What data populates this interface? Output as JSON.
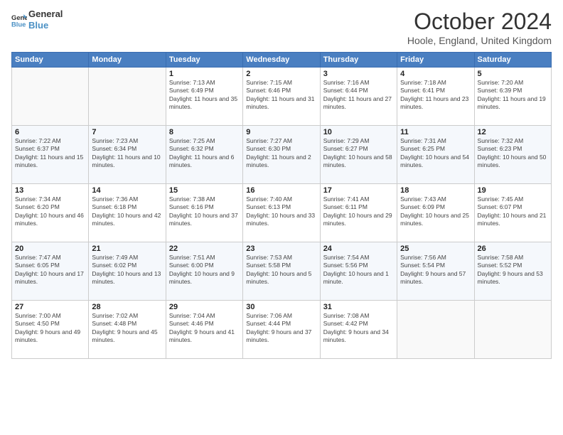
{
  "logo": {
    "line1": "General",
    "line2": "Blue"
  },
  "title": "October 2024",
  "location": "Hoole, England, United Kingdom",
  "days_of_week": [
    "Sunday",
    "Monday",
    "Tuesday",
    "Wednesday",
    "Thursday",
    "Friday",
    "Saturday"
  ],
  "weeks": [
    [
      {
        "day": "",
        "sunrise": "",
        "sunset": "",
        "daylight": ""
      },
      {
        "day": "",
        "sunrise": "",
        "sunset": "",
        "daylight": ""
      },
      {
        "day": "1",
        "sunrise": "Sunrise: 7:13 AM",
        "sunset": "Sunset: 6:49 PM",
        "daylight": "Daylight: 11 hours and 35 minutes."
      },
      {
        "day": "2",
        "sunrise": "Sunrise: 7:15 AM",
        "sunset": "Sunset: 6:46 PM",
        "daylight": "Daylight: 11 hours and 31 minutes."
      },
      {
        "day": "3",
        "sunrise": "Sunrise: 7:16 AM",
        "sunset": "Sunset: 6:44 PM",
        "daylight": "Daylight: 11 hours and 27 minutes."
      },
      {
        "day": "4",
        "sunrise": "Sunrise: 7:18 AM",
        "sunset": "Sunset: 6:41 PM",
        "daylight": "Daylight: 11 hours and 23 minutes."
      },
      {
        "day": "5",
        "sunrise": "Sunrise: 7:20 AM",
        "sunset": "Sunset: 6:39 PM",
        "daylight": "Daylight: 11 hours and 19 minutes."
      }
    ],
    [
      {
        "day": "6",
        "sunrise": "Sunrise: 7:22 AM",
        "sunset": "Sunset: 6:37 PM",
        "daylight": "Daylight: 11 hours and 15 minutes."
      },
      {
        "day": "7",
        "sunrise": "Sunrise: 7:23 AM",
        "sunset": "Sunset: 6:34 PM",
        "daylight": "Daylight: 11 hours and 10 minutes."
      },
      {
        "day": "8",
        "sunrise": "Sunrise: 7:25 AM",
        "sunset": "Sunset: 6:32 PM",
        "daylight": "Daylight: 11 hours and 6 minutes."
      },
      {
        "day": "9",
        "sunrise": "Sunrise: 7:27 AM",
        "sunset": "Sunset: 6:30 PM",
        "daylight": "Daylight: 11 hours and 2 minutes."
      },
      {
        "day": "10",
        "sunrise": "Sunrise: 7:29 AM",
        "sunset": "Sunset: 6:27 PM",
        "daylight": "Daylight: 10 hours and 58 minutes."
      },
      {
        "day": "11",
        "sunrise": "Sunrise: 7:31 AM",
        "sunset": "Sunset: 6:25 PM",
        "daylight": "Daylight: 10 hours and 54 minutes."
      },
      {
        "day": "12",
        "sunrise": "Sunrise: 7:32 AM",
        "sunset": "Sunset: 6:23 PM",
        "daylight": "Daylight: 10 hours and 50 minutes."
      }
    ],
    [
      {
        "day": "13",
        "sunrise": "Sunrise: 7:34 AM",
        "sunset": "Sunset: 6:20 PM",
        "daylight": "Daylight: 10 hours and 46 minutes."
      },
      {
        "day": "14",
        "sunrise": "Sunrise: 7:36 AM",
        "sunset": "Sunset: 6:18 PM",
        "daylight": "Daylight: 10 hours and 42 minutes."
      },
      {
        "day": "15",
        "sunrise": "Sunrise: 7:38 AM",
        "sunset": "Sunset: 6:16 PM",
        "daylight": "Daylight: 10 hours and 37 minutes."
      },
      {
        "day": "16",
        "sunrise": "Sunrise: 7:40 AM",
        "sunset": "Sunset: 6:13 PM",
        "daylight": "Daylight: 10 hours and 33 minutes."
      },
      {
        "day": "17",
        "sunrise": "Sunrise: 7:41 AM",
        "sunset": "Sunset: 6:11 PM",
        "daylight": "Daylight: 10 hours and 29 minutes."
      },
      {
        "day": "18",
        "sunrise": "Sunrise: 7:43 AM",
        "sunset": "Sunset: 6:09 PM",
        "daylight": "Daylight: 10 hours and 25 minutes."
      },
      {
        "day": "19",
        "sunrise": "Sunrise: 7:45 AM",
        "sunset": "Sunset: 6:07 PM",
        "daylight": "Daylight: 10 hours and 21 minutes."
      }
    ],
    [
      {
        "day": "20",
        "sunrise": "Sunrise: 7:47 AM",
        "sunset": "Sunset: 6:05 PM",
        "daylight": "Daylight: 10 hours and 17 minutes."
      },
      {
        "day": "21",
        "sunrise": "Sunrise: 7:49 AM",
        "sunset": "Sunset: 6:02 PM",
        "daylight": "Daylight: 10 hours and 13 minutes."
      },
      {
        "day": "22",
        "sunrise": "Sunrise: 7:51 AM",
        "sunset": "Sunset: 6:00 PM",
        "daylight": "Daylight: 10 hours and 9 minutes."
      },
      {
        "day": "23",
        "sunrise": "Sunrise: 7:53 AM",
        "sunset": "Sunset: 5:58 PM",
        "daylight": "Daylight: 10 hours and 5 minutes."
      },
      {
        "day": "24",
        "sunrise": "Sunrise: 7:54 AM",
        "sunset": "Sunset: 5:56 PM",
        "daylight": "Daylight: 10 hours and 1 minute."
      },
      {
        "day": "25",
        "sunrise": "Sunrise: 7:56 AM",
        "sunset": "Sunset: 5:54 PM",
        "daylight": "Daylight: 9 hours and 57 minutes."
      },
      {
        "day": "26",
        "sunrise": "Sunrise: 7:58 AM",
        "sunset": "Sunset: 5:52 PM",
        "daylight": "Daylight: 9 hours and 53 minutes."
      }
    ],
    [
      {
        "day": "27",
        "sunrise": "Sunrise: 7:00 AM",
        "sunset": "Sunset: 4:50 PM",
        "daylight": "Daylight: 9 hours and 49 minutes."
      },
      {
        "day": "28",
        "sunrise": "Sunrise: 7:02 AM",
        "sunset": "Sunset: 4:48 PM",
        "daylight": "Daylight: 9 hours and 45 minutes."
      },
      {
        "day": "29",
        "sunrise": "Sunrise: 7:04 AM",
        "sunset": "Sunset: 4:46 PM",
        "daylight": "Daylight: 9 hours and 41 minutes."
      },
      {
        "day": "30",
        "sunrise": "Sunrise: 7:06 AM",
        "sunset": "Sunset: 4:44 PM",
        "daylight": "Daylight: 9 hours and 37 minutes."
      },
      {
        "day": "31",
        "sunrise": "Sunrise: 7:08 AM",
        "sunset": "Sunset: 4:42 PM",
        "daylight": "Daylight: 9 hours and 34 minutes."
      },
      {
        "day": "",
        "sunrise": "",
        "sunset": "",
        "daylight": ""
      },
      {
        "day": "",
        "sunrise": "",
        "sunset": "",
        "daylight": ""
      }
    ]
  ]
}
